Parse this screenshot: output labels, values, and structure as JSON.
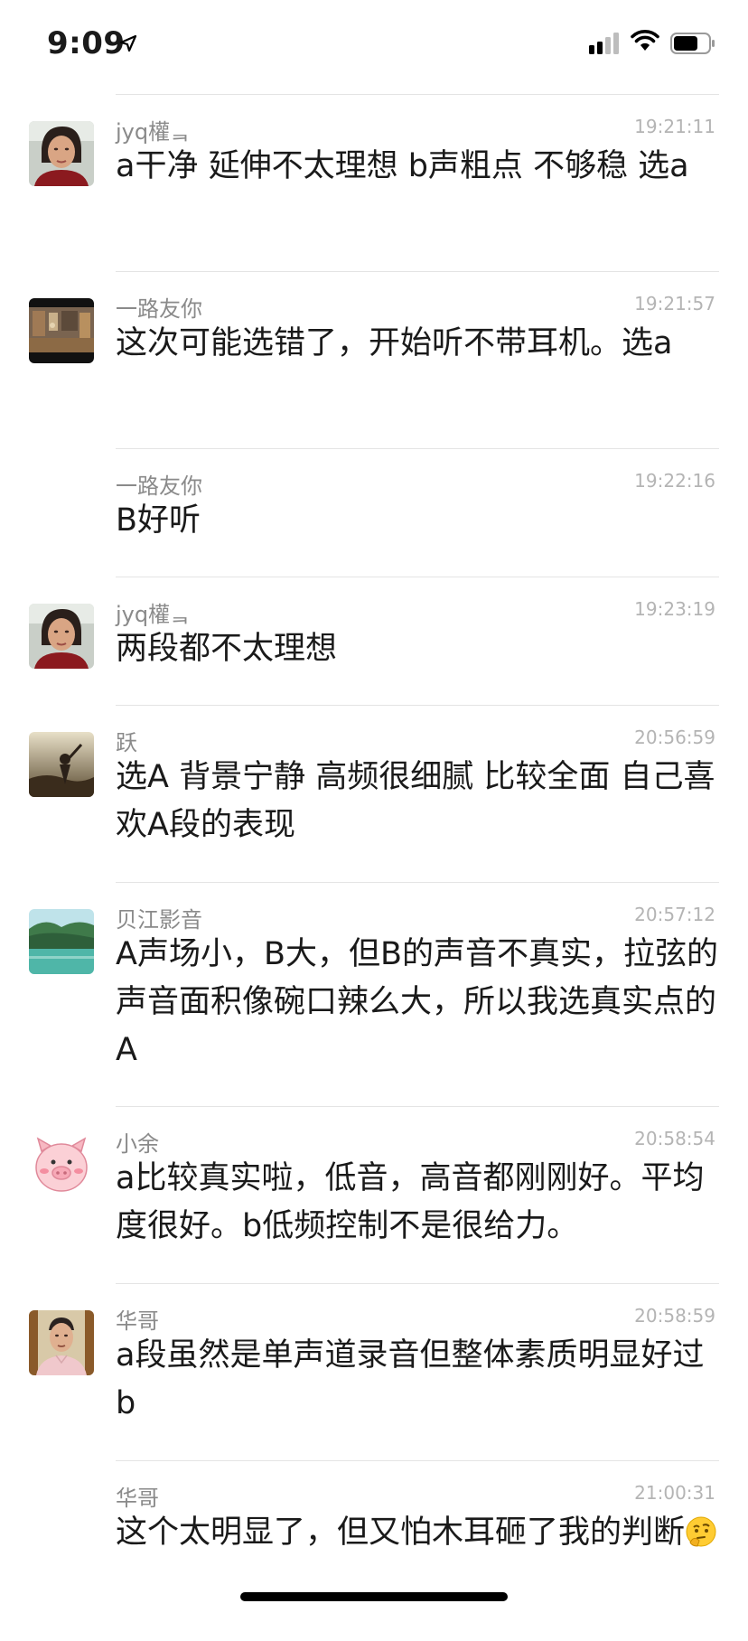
{
  "status_bar": {
    "time": "9:09",
    "location_icon": "location-arrow-icon",
    "signal_icon": "cellular-signal-icon",
    "wifi_icon": "wifi-icon",
    "battery_icon": "battery-icon"
  },
  "messages": [
    {
      "name": "jyq權ᆿ",
      "time": "19:21:11",
      "text": " a干净 延伸不太理想 b声粗点 不够稳 选a",
      "avatar": "woman-portrait-avatar"
    },
    {
      "name": "一路友你",
      "time": "19:21:57",
      "text": "这次可能选错了，开始听不带耳机。选a",
      "avatar": "room-photo-avatar"
    },
    {
      "name": "一路友你",
      "time": "19:22:16",
      "text": "B好听",
      "avatar": ""
    },
    {
      "name": "jyq權ᆿ",
      "time": "19:23:19",
      "text": "两段都不太理想",
      "avatar": "woman-portrait-avatar"
    },
    {
      "name": "跃",
      "time": "20:56:59",
      "text": "选A 背景宁静  高频很细腻  比较全面 自己喜欢A段的表现",
      "avatar": "sunset-silhouette-avatar"
    },
    {
      "name": "贝江影音",
      "time": "20:57:12",
      "text": "A声场小，B大，但B的声音不真实，拉弦的声音面积像碗口辣么大，所以我选真实点的A",
      "avatar": "river-landscape-avatar"
    },
    {
      "name": "小余",
      "time": "20:58:54",
      "text": "a比较真实啦，低音，高音都刚刚好。平均度很好。b低频控制不是很给力。",
      "avatar": "pig-cartoon-avatar"
    },
    {
      "name": "华哥",
      "time": "20:58:59",
      "text": "a段虽然是单声道录音但整体素质明显好过b",
      "avatar": "man-portrait-avatar"
    },
    {
      "name": "华哥",
      "time": "21:00:31",
      "text": "这个太明显了，但又怕木耳砸了我的判断",
      "avatar": ""
    }
  ],
  "colors": {
    "name": "#8a8a8a",
    "time": "#b4b4b4",
    "divider": "#e4e4e4",
    "text": "#1a1a1a"
  }
}
